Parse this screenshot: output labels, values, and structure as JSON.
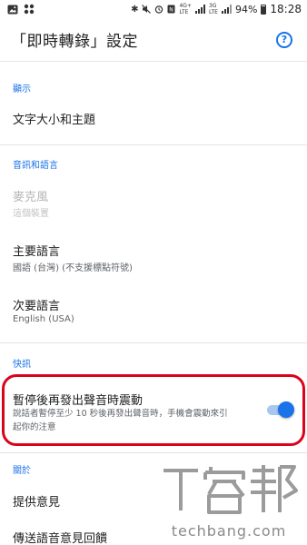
{
  "status_bar": {
    "battery": "94%",
    "time": "18:28",
    "icons": [
      "image-icon",
      "grid-dots-icon",
      "bluetooth-icon",
      "mute-icon",
      "alarm-icon",
      "nfc-icon",
      "signal-icon",
      "battery-icon"
    ],
    "net_4g_top": "4G+",
    "net_4g_bottom": "LTE",
    "net_3g_top": "3G",
    "net_3g_bottom": "LTE"
  },
  "app_bar": {
    "title": "「即時轉錄」設定",
    "help_icon": "help-circle-icon",
    "help_glyph": "?"
  },
  "sections": {
    "display": {
      "header": "顯示",
      "text_size": {
        "title": "文字大小和主題"
      }
    },
    "audio": {
      "header": "音訊和語言",
      "microphone": {
        "title": "麥克風",
        "subtitle": "這個裝置"
      },
      "primary_language": {
        "title": "主要語言",
        "subtitle": "國語 (台灣) (不支援標點符號)"
      },
      "secondary_language": {
        "title": "次要語言",
        "subtitle": "English (USA)"
      }
    },
    "quick": {
      "header": "快訊",
      "vibrate": {
        "title": "暫停後再發出聲音時震動",
        "description": "說話者暫停至少 10 秒後再發出聲音時，手機會震動來引起你的注意",
        "enabled": true
      }
    },
    "about": {
      "header": "關於",
      "feedback": {
        "title": "提供意見"
      },
      "voice_feedback": {
        "title": "傳送語音意見回饋"
      }
    }
  },
  "colors": {
    "accent": "#1a73e8",
    "highlight_border": "#d9041b",
    "toggle_track": "#a8c7f0"
  },
  "watermark": {
    "logo_text": "T客邦",
    "site": "techbang.com"
  }
}
